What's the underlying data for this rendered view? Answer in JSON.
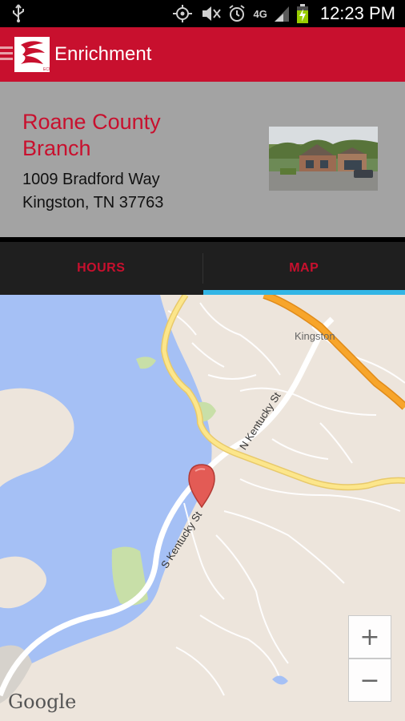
{
  "status_bar": {
    "time": "12:23 PM",
    "network": "4G",
    "icons": [
      "usb-icon",
      "location-icon",
      "mute-icon",
      "alarm-icon",
      "signal-icon",
      "battery-charging-icon"
    ]
  },
  "action_bar": {
    "title": "Enrichment",
    "icons": [
      "drawer-icon",
      "app-logo-icon"
    ]
  },
  "branch": {
    "name": "Roane County Branch",
    "address_line1": "1009 Bradford Way",
    "address_line2": "Kingston, TN  37763",
    "photo": "branch-building-photo"
  },
  "tabs": [
    {
      "label": "HOURS",
      "active": false
    },
    {
      "label": "MAP",
      "active": true
    }
  ],
  "map": {
    "place_label": "Kingston",
    "streets": [
      "N Kentucky St",
      "S Kentucky St"
    ],
    "zoom_in": "+",
    "zoom_out": "−",
    "attribution": "Google"
  },
  "colors": {
    "brand_red": "#c8102e",
    "tab_indicator": "#33b5e5",
    "water": "#a5c0f5",
    "land": "#ede5dc",
    "park": "#c8dfa8",
    "highway": "#f7a52b",
    "major_road": "#fce68b"
  }
}
